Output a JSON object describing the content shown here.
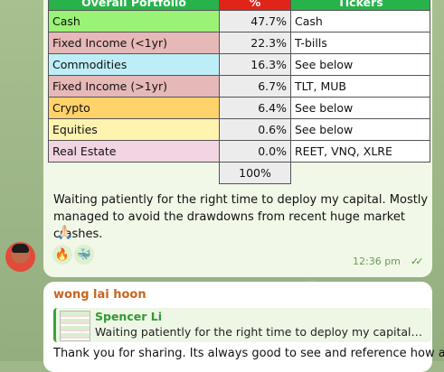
{
  "portfolio_table": {
    "headers": [
      "Overall Portfolio",
      "%",
      "Tickers"
    ],
    "rows": [
      {
        "name": "Cash",
        "pct": "47.7%",
        "tickers": "Cash",
        "color": "#9af277"
      },
      {
        "name": "Fixed Income (<1yr)",
        "pct": "22.3%",
        "tickers": "T-bills",
        "color": "#e6b8b7"
      },
      {
        "name": "Commodities",
        "pct": "16.3%",
        "tickers": "See below",
        "color": "#bdeef7"
      },
      {
        "name": "Fixed Income (>1yr)",
        "pct": "6.7%",
        "tickers": "TLT, MUB",
        "color": "#e6b8b7"
      },
      {
        "name": "Crypto",
        "pct": "6.4%",
        "tickers": "See below",
        "color": "#ffd26a"
      },
      {
        "name": "Equities",
        "pct": "0.6%",
        "tickers": "See below",
        "color": "#fff3b0"
      },
      {
        "name": "Real Estate",
        "pct": "0.0%",
        "tickers": "REET, VNQ, XLRE",
        "color": "#f2d4e3"
      }
    ],
    "total": "100%"
  },
  "message1": {
    "text": "Waiting patiently for the right time to deploy my capital. Mostly managed to avoid the drawdowns from recent huge market crashes.",
    "emoji": "🙏🏻",
    "reactions": [
      "🔥",
      "🐳"
    ],
    "time": "12:36 pm",
    "read_icon": "double-check-icon"
  },
  "message2": {
    "sender": "wong lai hoon",
    "reply_to_name": "Spencer Li",
    "reply_to_text": "Waiting patiently for the right time to deploy my capital. M...",
    "text": "Thank you for sharing. Its always good to see and reference how a"
  }
}
